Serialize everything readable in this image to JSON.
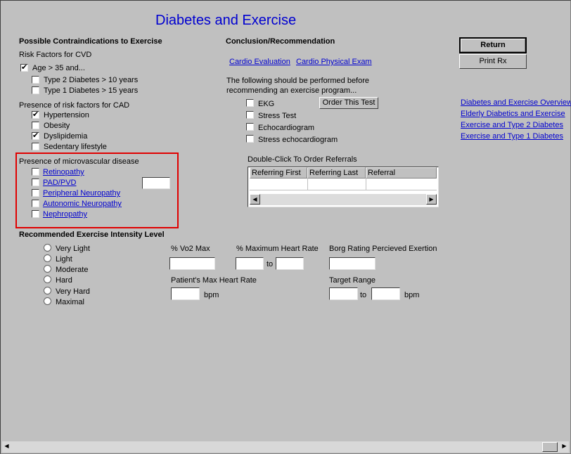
{
  "title": "Diabetes and Exercise",
  "contraindications": {
    "heading": "Possible Contraindications to Exercise",
    "cvd_label": "Risk Factors for CVD",
    "age": {
      "label": "Age > 35 and...",
      "checked": true
    },
    "type2": {
      "label": "Type 2 Diabetes > 10 years",
      "checked": false
    },
    "type1": {
      "label": "Type 1 Diabetes > 15 years",
      "checked": false
    },
    "cad_label": "Presence of risk factors for CAD",
    "cad": [
      {
        "label": "Hypertension",
        "checked": true
      },
      {
        "label": "Obesity",
        "checked": false
      },
      {
        "label": "Dyslipidemia",
        "checked": true
      },
      {
        "label": "Sedentary lifestyle",
        "checked": false
      }
    ],
    "micro_label": "Presence of microvascular disease",
    "micro": [
      {
        "label": "Retinopathy",
        "checked": false
      },
      {
        "label": "PAD/PVD",
        "checked": false
      },
      {
        "label": "Peripheral Neuropathy",
        "checked": false
      },
      {
        "label": "Autonomic Neuropathy",
        "checked": false
      },
      {
        "label": "Nephropathy",
        "checked": false
      }
    ]
  },
  "conclusion": {
    "heading": "Conclusion/Recommendation",
    "cardio_eval": "Cardio Evaluation",
    "cardio_exam": "Cardio Physical Exam",
    "instructions_line1": "The following should be performed before",
    "instructions_line2": "recommending an exercise program...",
    "order_button": "Order This Test",
    "tests": [
      {
        "label": "EKG",
        "checked": false
      },
      {
        "label": "Stress Test",
        "checked": false
      },
      {
        "label": "Echocardiogram",
        "checked": false
      },
      {
        "label": "Stress echocardiogram",
        "checked": false
      }
    ],
    "referrals_label": "Double-Click To Order Referrals",
    "referral_columns": [
      "Referring First",
      "Referring Last",
      "Referral"
    ]
  },
  "buttons": {
    "return": "Return",
    "print": "Print Rx"
  },
  "links": [
    "Diabetes and Exercise Overview",
    "Elderly Diabetics and Exercise",
    "Exercise and Type 2 Diabetes",
    "Exercise and Type 1 Diabetes"
  ],
  "intensity": {
    "heading": "Recommended Exercise Intensity Level",
    "levels": [
      "Very Light",
      "Light",
      "Moderate",
      "Hard",
      "Very Hard",
      "Maximal"
    ],
    "vo2_label": "% Vo2 Max",
    "max_hr_label": "% Maximum Heart Rate",
    "to1": "to",
    "borg_label": "Borg Rating Percieved Exertion",
    "patient_max_hr_label": "Patient's Max Heart Rate",
    "bpm1": "bpm",
    "target_range_label": "Target Range",
    "to2": "to",
    "bpm2": "bpm"
  },
  "colors": {
    "link": "#0000d0",
    "highlight_box": "#e00000",
    "background": "#c0c0c0"
  }
}
